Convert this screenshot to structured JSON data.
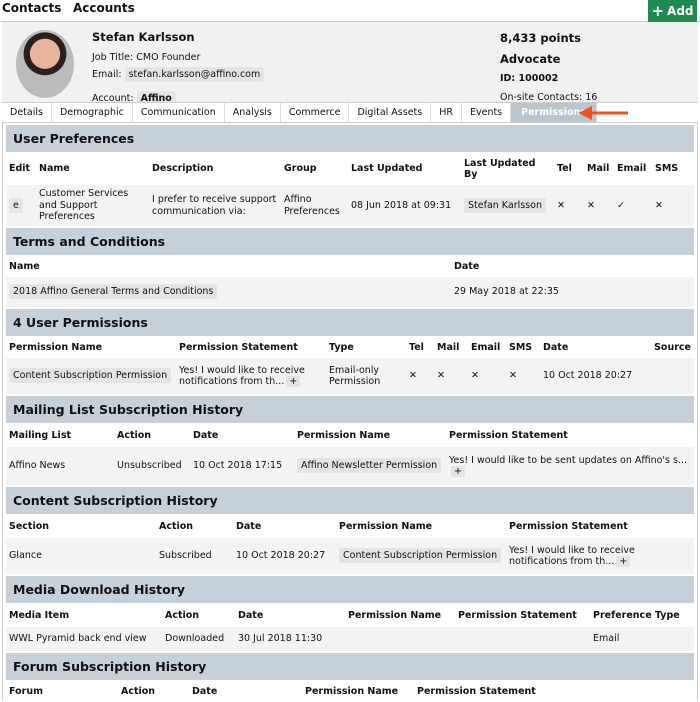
{
  "nav": {
    "contacts": "Contacts",
    "accounts": "Accounts",
    "add_label": "Add",
    "add_icon": "+"
  },
  "profile": {
    "name": "Stefan Karlsson",
    "job_label": "Job Title:",
    "job": "CMO Founder",
    "email_label": "Email:",
    "email": "stefan.karlsson@affino.com",
    "account_label": "Account:",
    "account": "Affino",
    "points": "8,433 points",
    "level": "Advocate",
    "id": "ID: 100002",
    "onsite": "On-site Contacts: 16"
  },
  "tabs": [
    "Details",
    "Demographic",
    "Communication",
    "Analysis",
    "Commerce",
    "Digital Assets",
    "HR",
    "Events",
    "Permissions"
  ],
  "colors": {
    "accent": "#1f8a52",
    "section": "#c6d0d8",
    "active_tab": "#b9c6d1",
    "arrow": "#f0531c"
  },
  "user_prefs": {
    "title": "User Preferences",
    "headers": [
      "Edit",
      "Name",
      "Description",
      "Group",
      "Last Updated",
      "Last Updated By",
      "Tel",
      "Mail",
      "Email",
      "SMS"
    ],
    "row": {
      "edit": "e",
      "name": "Customer Services and Support Preferences",
      "description": "I prefer to receive support communication via:",
      "group": "Affino Preferences",
      "updated": "08 Jun 2018 at 09:31",
      "by": "Stefan Karlsson",
      "tel": "✕",
      "mail": "✕",
      "email": "✓",
      "sms": "✕"
    }
  },
  "terms": {
    "title": "Terms and Conditions",
    "headers": [
      "Name",
      "Date"
    ],
    "row": {
      "name": "2018 Affino General Terms and Conditions",
      "date": "29 May 2018 at 22:35"
    }
  },
  "perms": {
    "title": "4 User Permissions",
    "headers": [
      "Permission Name",
      "Permission Statement",
      "Type",
      "Tel",
      "Mail",
      "Email",
      "SMS",
      "Date",
      "Source"
    ],
    "row": {
      "name": "Content Subscription Permission",
      "statement": "Yes! I would like to receive notifications from th...",
      "type": "Email-only Permission",
      "tel": "✕",
      "mail": "✕",
      "email": "✕",
      "sms": "✕",
      "date": "10 Oct 2018 20:27",
      "source": ""
    }
  },
  "mailing": {
    "title": "Mailing List Subscription History",
    "headers": [
      "Mailing List",
      "Action",
      "Date",
      "Permission Name",
      "Permission Statement"
    ],
    "row": {
      "list": "Affino News",
      "action": "Unsubscribed",
      "date": "10 Oct 2018 17:15",
      "perm": "Affino Newsletter Permission",
      "statement": "Yes! I would like to be sent updates on Affino's s..."
    }
  },
  "content_sub": {
    "title": "Content Subscription History",
    "headers": [
      "Section",
      "Action",
      "Date",
      "Permission Name",
      "Permission Statement"
    ],
    "row": {
      "section": "Glance",
      "action": "Subscribed",
      "date": "10 Oct 2018 20:27",
      "perm": "Content Subscription Permission",
      "statement": "Yes! I would like to receive notifications from th..."
    }
  },
  "media": {
    "title": "Media Download History",
    "headers": [
      "Media Item",
      "Action",
      "Date",
      "Permission Name",
      "Permission Statement",
      "Preference Type"
    ],
    "row": {
      "item": "WWL Pyramid back end view",
      "action": "Downloaded",
      "date": "30 Jul 2018 11:30",
      "perm": "",
      "statement": "",
      "pref": "Email"
    }
  },
  "forum": {
    "title": "Forum Subscription History",
    "headers": [
      "Forum",
      "Action",
      "Date",
      "Permission Name",
      "Permission Statement"
    ]
  },
  "plus": "+"
}
